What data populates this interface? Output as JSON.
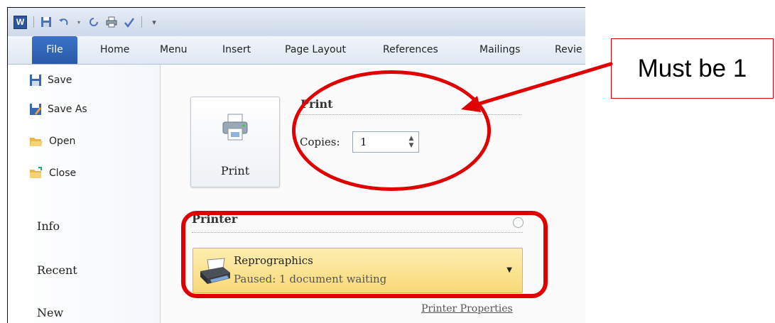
{
  "app": {
    "word_icon_letter": "W",
    "accent": "#2b579a"
  },
  "ribbon": {
    "tabs": [
      {
        "label": "File"
      },
      {
        "label": "Home"
      },
      {
        "label": "Menu"
      },
      {
        "label": "Insert"
      },
      {
        "label": "Page Layout"
      },
      {
        "label": "References"
      },
      {
        "label": "Mailings"
      },
      {
        "label": "Revie"
      }
    ]
  },
  "nav": {
    "commands": [
      {
        "label": "Save",
        "icon": "save-icon"
      },
      {
        "label": "Save As",
        "icon": "save-as-icon"
      },
      {
        "label": "Open",
        "icon": "open-folder-icon"
      },
      {
        "label": "Close",
        "icon": "close-folder-icon"
      }
    ],
    "sections": [
      {
        "label": "Info"
      },
      {
        "label": "Recent"
      },
      {
        "label": "New"
      }
    ]
  },
  "print": {
    "button_label": "Print",
    "heading": "Print",
    "copies_label": "Copies:",
    "copies_value": "1",
    "printer_heading": "Printer",
    "printer_name": "Reprographics",
    "printer_status": "Paused: 1 document waiting",
    "printer_properties_link": "Printer Properties"
  },
  "annotation": {
    "callout_text": "Must be 1",
    "color": "#e00000"
  }
}
